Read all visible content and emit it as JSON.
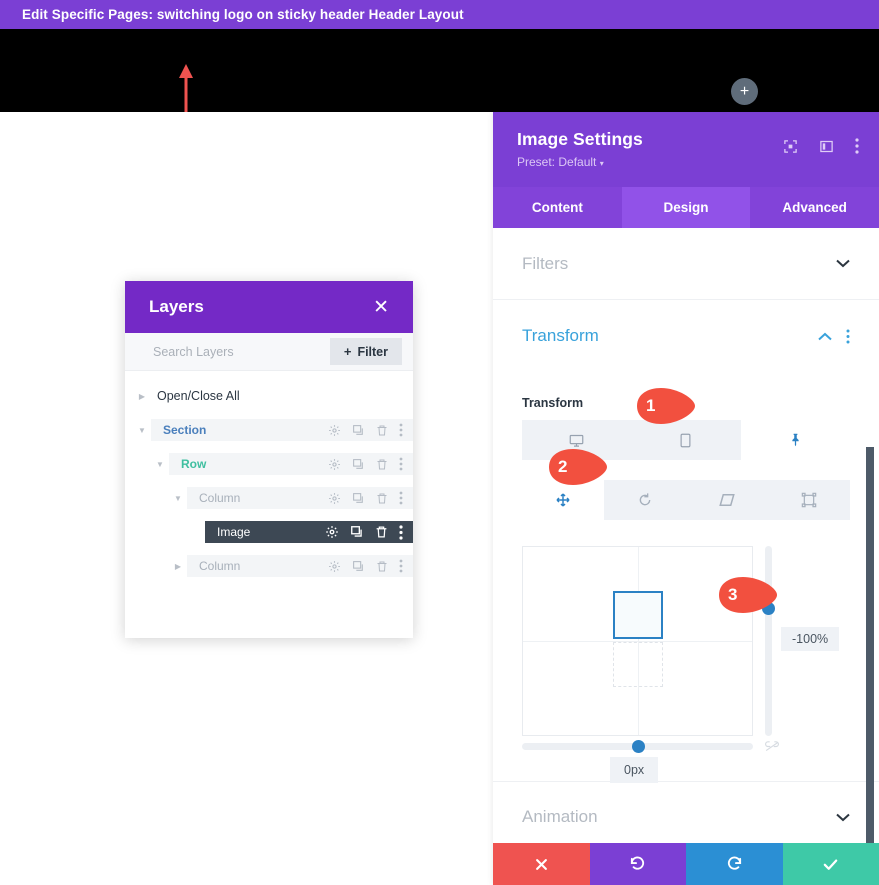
{
  "topbar": {
    "title": "Edit Specific Pages: switching logo on sticky header Header Layout",
    "bg": "#7b3fd4"
  },
  "canvas": {
    "bg": "#000000",
    "add_button_label": "+",
    "annotation_arrow": "up-arrow-red",
    "arrow_color": "#ef5350"
  },
  "layers_panel": {
    "title": "Layers",
    "close_label": "✕",
    "search_placeholder": "Search Layers",
    "search_value": "",
    "filter_label": "Filter",
    "filter_plus": "+",
    "open_close_all": "Open/Close All",
    "header_bg": "#7429c6",
    "rows": [
      {
        "label": "Section",
        "depth": 0,
        "caret": "down",
        "style": "section",
        "selected": false
      },
      {
        "label": "Row",
        "depth": 1,
        "caret": "down",
        "style": "row",
        "selected": false
      },
      {
        "label": "Column",
        "depth": 2,
        "caret": "down",
        "style": "column",
        "selected": false
      },
      {
        "label": "Image",
        "depth": 3,
        "caret": "none",
        "style": "image",
        "selected": true
      },
      {
        "label": "Column",
        "depth": 2,
        "caret": "right",
        "style": "column",
        "selected": false
      }
    ],
    "row_icons": [
      "gear-icon",
      "duplicate-icon",
      "trash-icon",
      "more-vertical-icon"
    ]
  },
  "settings_panel": {
    "title": "Image Settings",
    "preset_label": "Preset: Default",
    "preset_caret": "▾",
    "header_bg": "#7b3fd4",
    "header_icons": [
      "expand-icon",
      "panel-layout-icon",
      "more-vertical-icon"
    ],
    "tabs": [
      {
        "label": "Content",
        "active": false
      },
      {
        "label": "Design",
        "active": true
      },
      {
        "label": "Advanced",
        "active": false
      }
    ],
    "sections": [
      {
        "label": "Filters",
        "open": false,
        "chevron": "down"
      },
      {
        "label": "Transform",
        "open": true,
        "chevron": "up"
      },
      {
        "label": "Animation",
        "open": false,
        "chevron": "down"
      }
    ],
    "transform": {
      "field_label": "Transform",
      "device_tabs": [
        {
          "icon": "desktop-icon",
          "active": false
        },
        {
          "icon": "tablet-icon",
          "active": false
        },
        {
          "icon": "phone-pin-icon",
          "active": true
        }
      ],
      "mode_tabs": [
        {
          "icon": "move-icon",
          "active": true
        },
        {
          "icon": "rotate-icon",
          "active": false
        },
        {
          "icon": "skew-icon",
          "active": false
        },
        {
          "icon": "scale-origin-icon",
          "active": false
        }
      ],
      "vertical_value": "-100%",
      "horizontal_value": "0px",
      "link_icon": "link-broken-icon",
      "accent_color": "#2b81c4"
    },
    "action_buttons": [
      {
        "name": "cancel",
        "icon": "✖",
        "color": "#ef5350"
      },
      {
        "name": "undo",
        "icon": "↺",
        "color": "#7b3fd4"
      },
      {
        "name": "redo",
        "icon": "↻",
        "color": "#2b8fd4"
      },
      {
        "name": "save",
        "icon": "✔",
        "color": "#3ec9a7"
      }
    ]
  },
  "callouts": [
    {
      "number": "1",
      "target": "transform-device-tab-group"
    },
    {
      "number": "2",
      "target": "transform-mode-move"
    },
    {
      "number": "3",
      "target": "transform-vertical-value"
    }
  ]
}
